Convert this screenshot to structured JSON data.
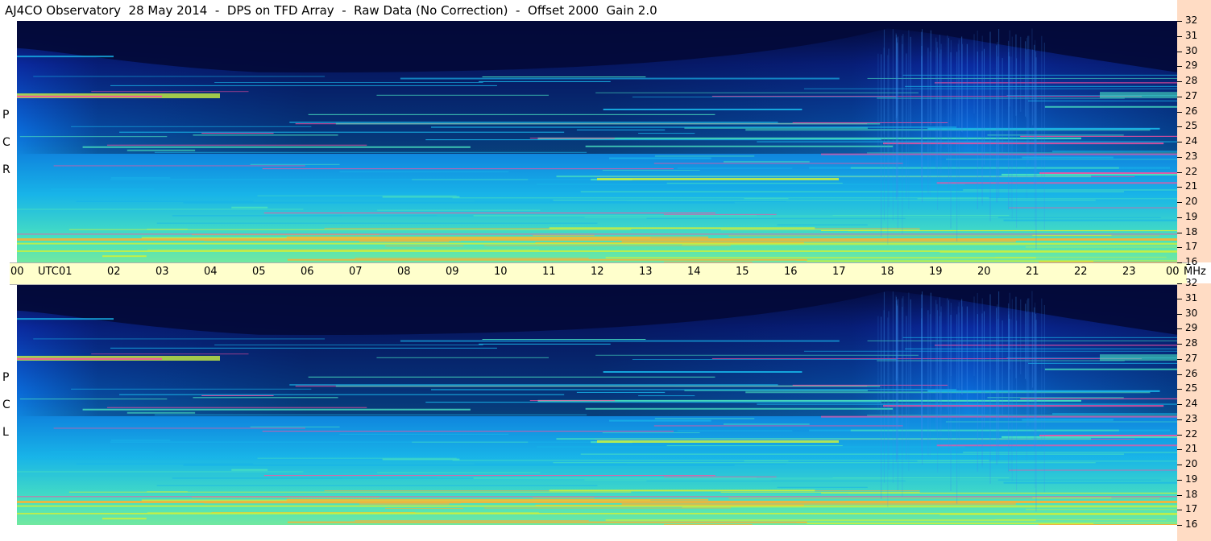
{
  "title": "AJ4CO Observatory  28 May 2014  -  DPS on TFD Array  -  Raw Data (No Correction)  -  Offset 2000  Gain 2.0",
  "colors": {
    "axis_band": "#ffffcc",
    "freq_band": "#ffdcc4",
    "night": "#030a3a",
    "day": "#0a6ad8",
    "hot": "#ff6a3c"
  },
  "chart_data": {
    "type": "heatmap",
    "panels": [
      {
        "label_letters": [
          "P",
          "C",
          "R"
        ],
        "polarization": "RCP"
      },
      {
        "label_letters": [
          "P",
          "C",
          "L"
        ],
        "polarization": "LCP"
      }
    ],
    "x_ticks": [
      "00",
      "01",
      "02",
      "03",
      "04",
      "05",
      "06",
      "07",
      "08",
      "09",
      "10",
      "11",
      "12",
      "13",
      "14",
      "15",
      "16",
      "17",
      "18",
      "19",
      "20",
      "21",
      "22",
      "23",
      "00"
    ],
    "x_unit": "UTC",
    "xlim_hours": [
      0,
      24
    ],
    "y_ticks": [
      "32",
      "31",
      "30",
      "29",
      "28",
      "27",
      "26",
      "25",
      "24",
      "23",
      "22",
      "21",
      "20",
      "19",
      "18",
      "17",
      "16"
    ],
    "y_unit": "MHz",
    "ylim_mhz": [
      16,
      32
    ],
    "colormap": [
      "#030a3a",
      "#0a2aa0",
      "#0a6ad8",
      "#18b4e8",
      "#48e0c0",
      "#c8f040",
      "#ffb030",
      "#ff4fa0"
    ]
  }
}
